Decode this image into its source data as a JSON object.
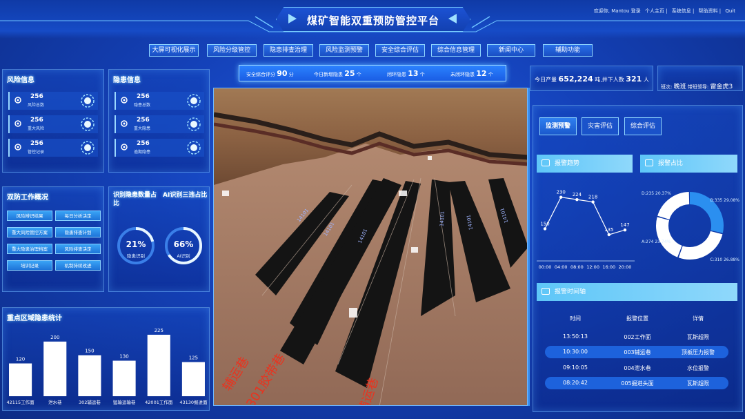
{
  "header": {
    "title": "煤矿智能双重预防管控平台",
    "welcome": "欢迎你, Mantou 登录",
    "links": [
      "个人主页",
      "系统信息",
      "帮助资料",
      "Quit"
    ]
  },
  "nav": [
    "大屏可视化展示",
    "风险分级管控",
    "隐患排查治理",
    "风险监测预警",
    "安全综合评估",
    "综合信息管理",
    "新闻中心",
    "辅助功能"
  ],
  "risk_panel": {
    "title": "风险信息",
    "items": [
      {
        "value": "256",
        "label": "风险总数"
      },
      {
        "value": "256",
        "label": "重大风险"
      },
      {
        "value": "256",
        "label": "管控记录"
      }
    ]
  },
  "hazard_panel": {
    "title": "隐患信息",
    "items": [
      {
        "value": "256",
        "label": "隐患总数"
      },
      {
        "value": "256",
        "label": "重大隐患"
      },
      {
        "value": "256",
        "label": "逾期隐患"
      }
    ]
  },
  "work_panel": {
    "title": "双防工作概况",
    "buttons": [
      "风险辨识结果",
      "每日分析决定",
      "重大风险管控方案",
      "隐患排查计划",
      "重大隐患治理档案",
      "风险排查决定",
      "培训记录",
      "机制持续改进"
    ]
  },
  "identify_panel": {
    "title_left": "识别隐患数量占比",
    "title_right": "AI识别三违占比",
    "gauges": [
      {
        "value": "21%",
        "label": "隐患识别",
        "fraction": 0.21
      },
      {
        "value": "66%",
        "label": "AI识别",
        "fraction": 0.66
      }
    ]
  },
  "metrics": [
    {
      "label": "安全综合评分",
      "value": "90",
      "unit": "分"
    },
    {
      "label": "今日新增隐患",
      "value": "25",
      "unit": "个"
    },
    {
      "label": "闭环隐患",
      "value": "13",
      "unit": "个"
    },
    {
      "label": "未闭环隐患",
      "value": "12",
      "unit": "个"
    }
  ],
  "production": {
    "label": "今日产量",
    "value": "652,224",
    "unit": "吨",
    "people_label": ",井下人数",
    "people": "321",
    "people_unit": "人"
  },
  "shift": {
    "label": "班次:",
    "value": "晚班",
    "leader_label": "带班领导:",
    "leader": "雷金虎3"
  },
  "scene_labels": [
    "辅运巷",
    "301胶带巷",
    "辅运巷"
  ],
  "scene_stripe_labels": [
    "14101",
    "14101",
    "14101",
    "14101",
    "14101",
    "14101"
  ],
  "right_tabs": [
    "监测预警",
    "灾害评估",
    "综合评估"
  ],
  "trend": {
    "title": "报警趋势"
  },
  "ratio": {
    "title": "报警占比"
  },
  "timeline": {
    "title": "报警时间轴",
    "headers": [
      "时间",
      "报警位置",
      "详情"
    ],
    "rows": [
      [
        "13:50:13",
        "002工作面",
        "瓦斯超限"
      ],
      [
        "10:30:00",
        "003辅运巷",
        "顶板压力报警"
      ],
      [
        "09:10:05",
        "004泄水巷",
        "水位报警"
      ],
      [
        "08:20:42",
        "005掘进头面",
        "瓦斯超限"
      ]
    ]
  },
  "region_panel": {
    "title": "重点区域隐患统计"
  },
  "chart_data": [
    {
      "type": "line",
      "title": "报警趋势",
      "x": [
        "00:00",
        "04:00",
        "08:00",
        "12:00",
        "16:00",
        "20:00"
      ],
      "series": [
        {
          "values": [
            150,
            230,
            224,
            218,
            135,
            147
          ]
        }
      ]
    },
    {
      "type": "pie",
      "title": "报警占比",
      "labels": [
        "B:335 29.08%",
        "C:310 26.88%",
        "A:274 23.74%",
        "D:235 20.37%"
      ],
      "values": [
        335,
        310,
        274,
        235
      ],
      "colors": [
        "#2b8ff0",
        "#ffffff",
        "#ffffff",
        "#ffffff"
      ]
    },
    {
      "type": "bar",
      "title": "重点区域隐患统计",
      "categories": [
        "42115工作面",
        "泄水巷",
        "302辅运巷",
        "猛输运输巷",
        "42001工作面",
        "43130掘进面"
      ],
      "values": [
        120,
        200,
        150,
        130,
        225,
        125
      ]
    }
  ]
}
